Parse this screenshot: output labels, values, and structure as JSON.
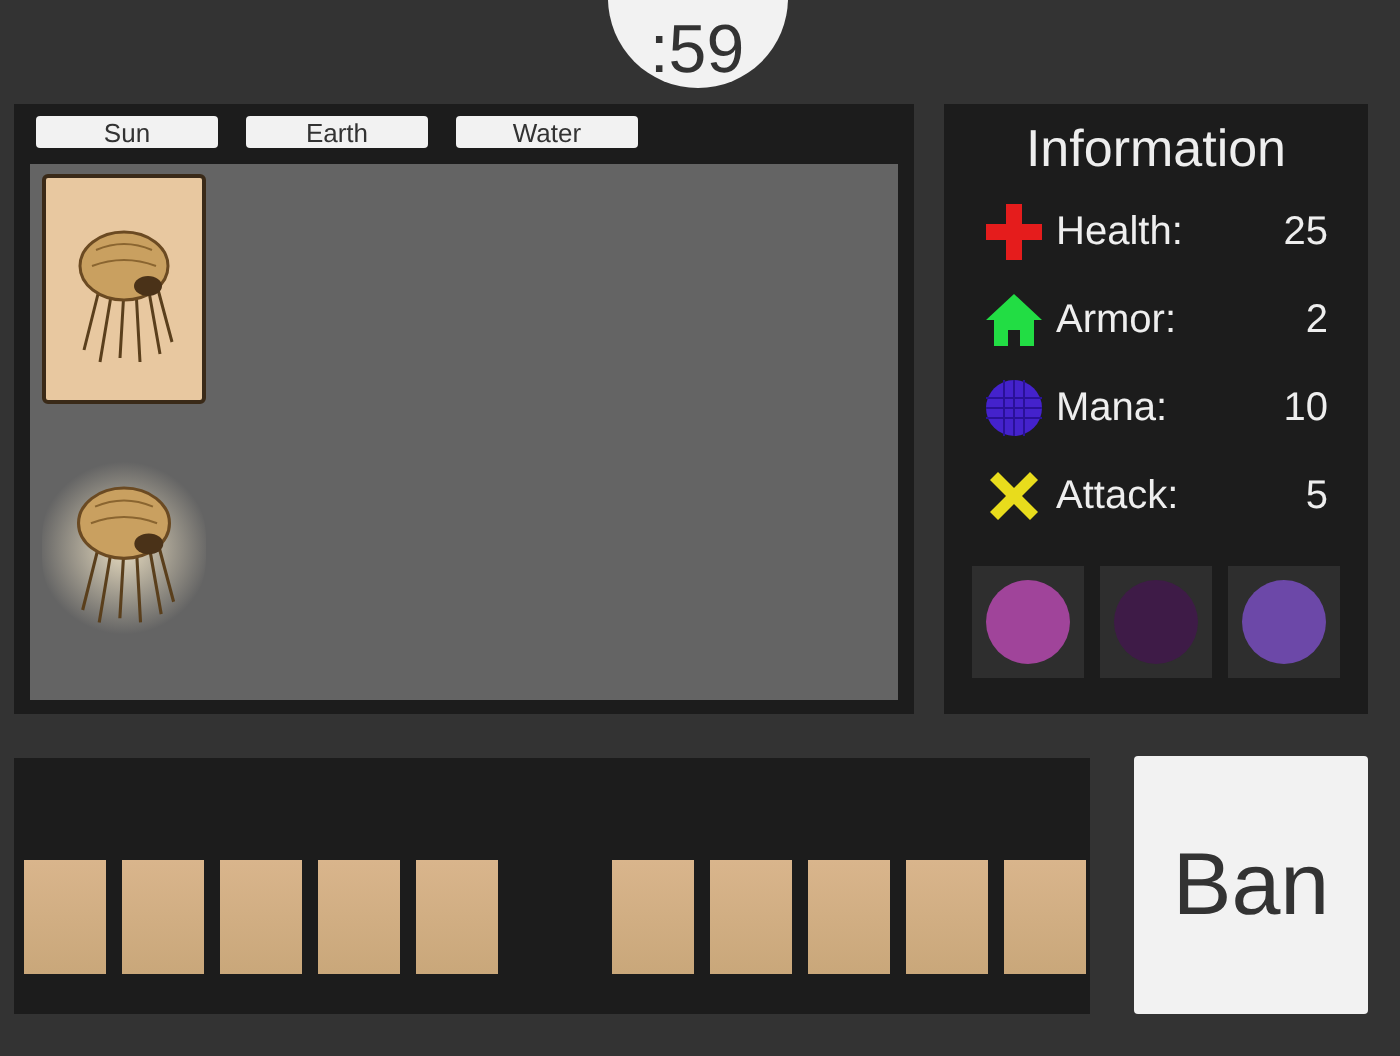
{
  "timer": ":59",
  "tabs": [
    {
      "label": "Sun"
    },
    {
      "label": "Earth"
    },
    {
      "label": "Water"
    }
  ],
  "information": {
    "title": "Information",
    "stats": [
      {
        "kind": "health",
        "label": "Health:",
        "value": "25"
      },
      {
        "kind": "armor",
        "label": "Armor:",
        "value": "2"
      },
      {
        "kind": "mana",
        "label": "Mana:",
        "value": "10"
      },
      {
        "kind": "attack",
        "label": "Attack:",
        "value": "5"
      }
    ],
    "swatches": [
      {
        "color": "#a0449a"
      },
      {
        "color": "#3e1b47"
      },
      {
        "color": "#6c48a8"
      }
    ]
  },
  "ban_button": "Ban"
}
